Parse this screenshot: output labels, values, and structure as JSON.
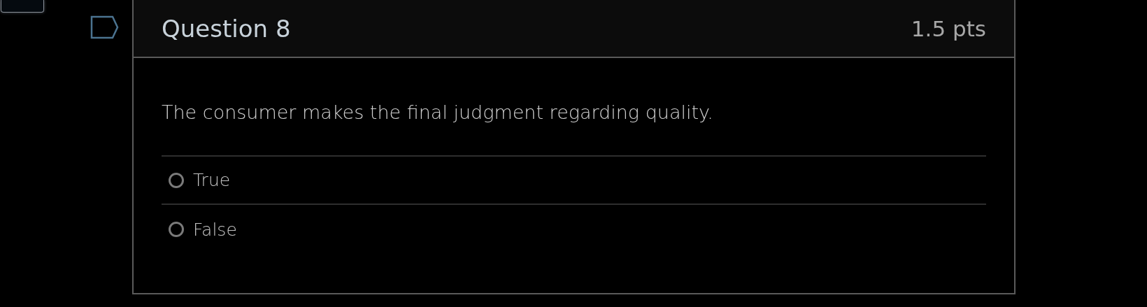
{
  "question": {
    "title": "Question 8",
    "points": "1.5 pts",
    "flagged": false,
    "text": "The consumer makes the final judgment regarding quality.",
    "answers": [
      {
        "label": "True",
        "selected": false
      },
      {
        "label": "False",
        "selected": false
      }
    ]
  }
}
